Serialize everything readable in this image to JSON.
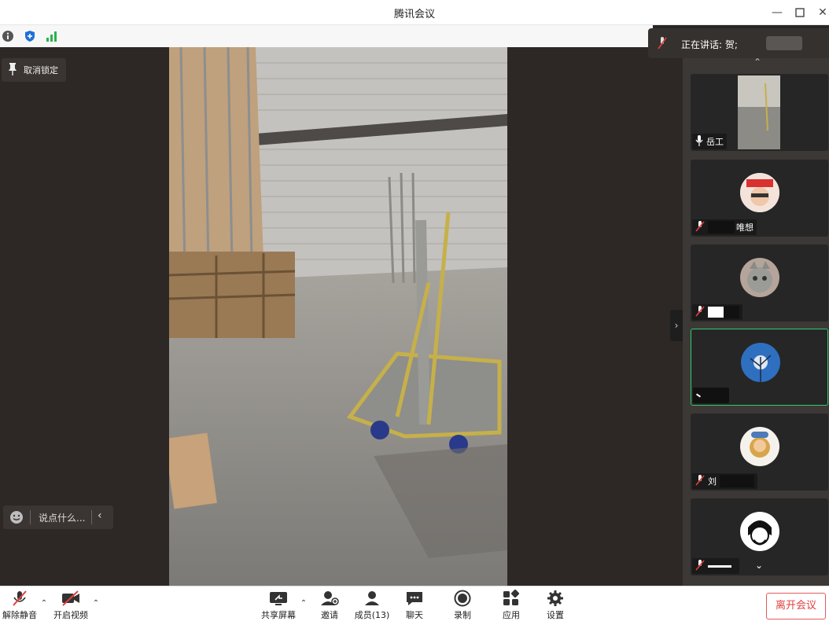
{
  "window": {
    "title": "腾讯会议"
  },
  "stage": {
    "unlock_label": "取消锁定",
    "chat_placeholder": "说点什么...",
    "speaking_label": "正在讲话: 贺;"
  },
  "participants": [
    {
      "name": "岳工",
      "mic": "on",
      "avatar": "video-thumbnail"
    },
    {
      "name": "唯想",
      "mic": "muted",
      "avatar": "red-hat-person"
    },
    {
      "name": "",
      "mic": "muted",
      "avatar": "cat"
    },
    {
      "name": "",
      "mic": "none",
      "avatar": "blue-tree"
    },
    {
      "name": "刘",
      "mic": "muted",
      "avatar": "cartoon-girl"
    },
    {
      "name": "",
      "mic": "muted",
      "avatar": "sketch-man"
    }
  ],
  "toolbar": {
    "unmute_label": "解除静音",
    "video_label": "开启视频",
    "share_label": "共享屏幕",
    "invite_label": "邀请",
    "members_label": "成员(13)",
    "chat_label": "聊天",
    "record_label": "录制",
    "apps_label": "应用",
    "settings_label": "设置",
    "leave_label": "离开会议"
  },
  "colors": {
    "accent_red": "#e04040",
    "active_green": "#2ecc71",
    "signal_green": "#2bb24c",
    "shield_blue": "#1e6fd9"
  }
}
